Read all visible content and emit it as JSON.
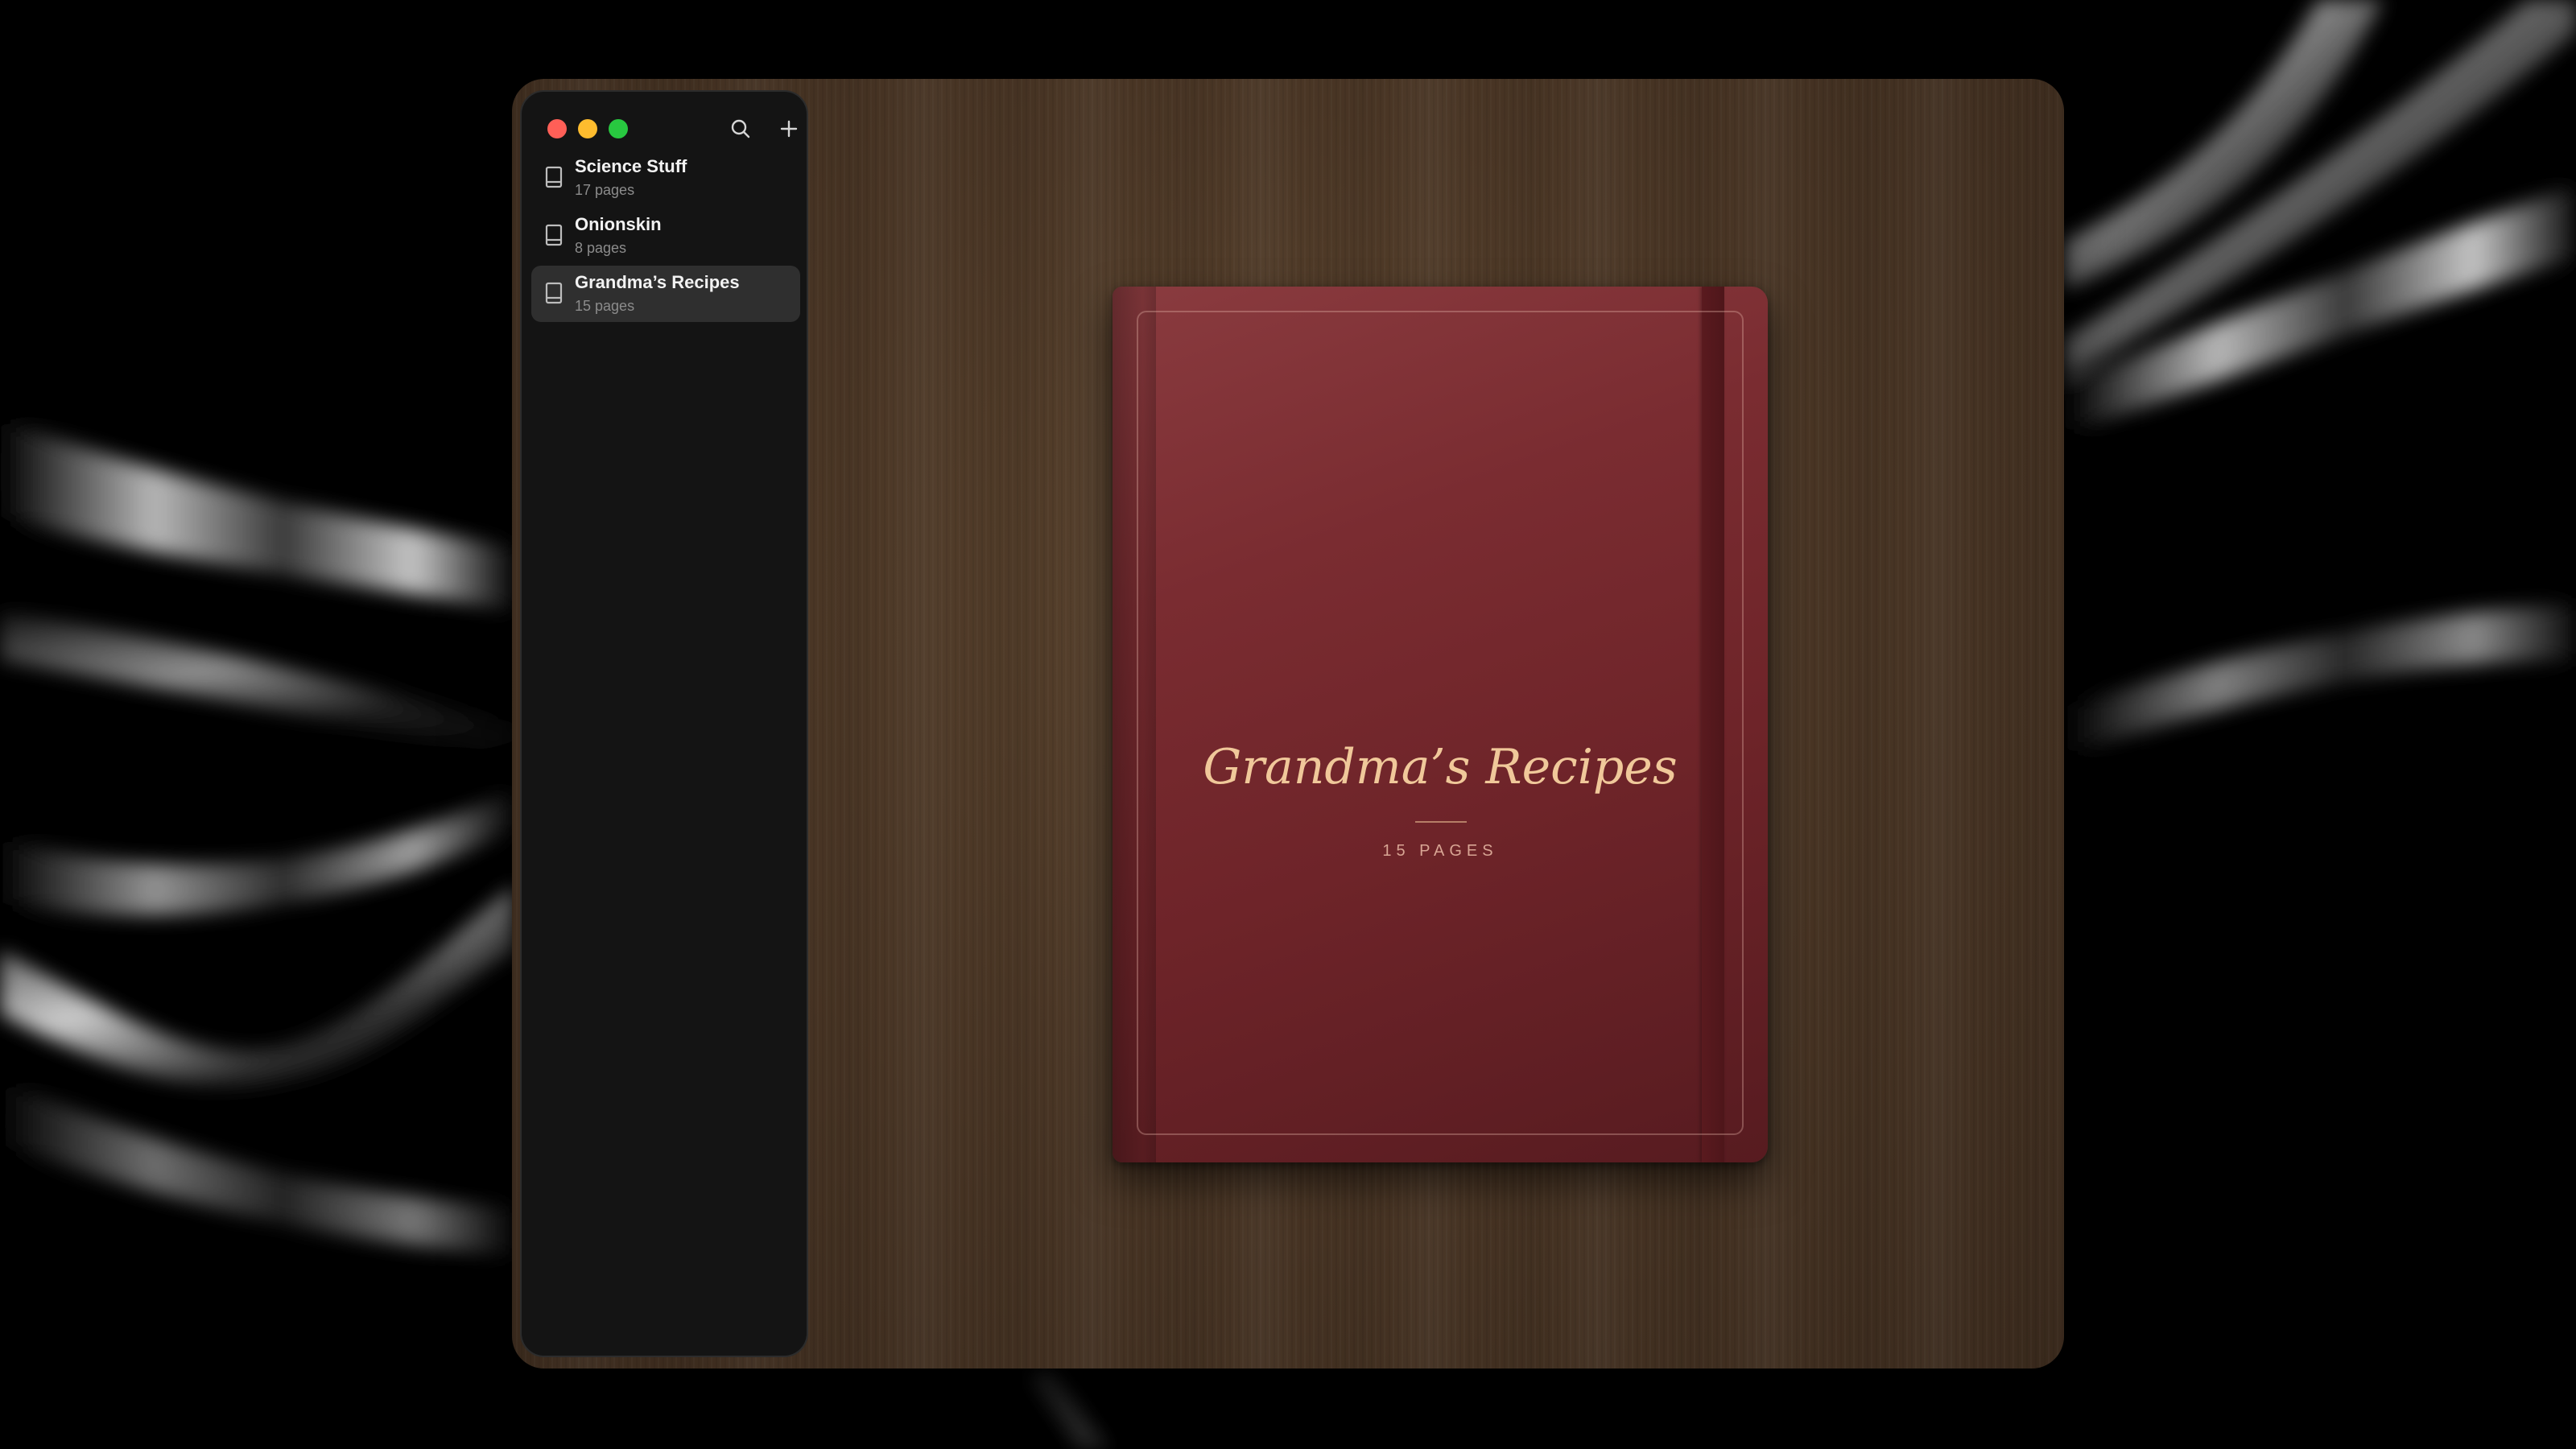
{
  "sidebar": {
    "toolbar": {
      "search_icon": "search-icon",
      "add_icon": "plus-icon"
    },
    "notebooks": [
      {
        "title": "Science Stuff",
        "subtitle": "17 pages",
        "icon": "book-icon",
        "selected": false
      },
      {
        "title": "Onionskin",
        "subtitle": "8 pages",
        "icon": "book-icon",
        "selected": false
      },
      {
        "title": "Grandma’s Recipes",
        "subtitle": "15 pages",
        "icon": "book-icon",
        "selected": true
      }
    ]
  },
  "cover": {
    "title": "Grandma’s Recipes",
    "pages_label": "15 PAGES"
  },
  "colors": {
    "cover": "#7a2c31",
    "desk": "#4a3625",
    "sidebar": "#141414",
    "close": "#ff5f57",
    "minimize": "#febc2e",
    "maximize": "#28c840"
  }
}
